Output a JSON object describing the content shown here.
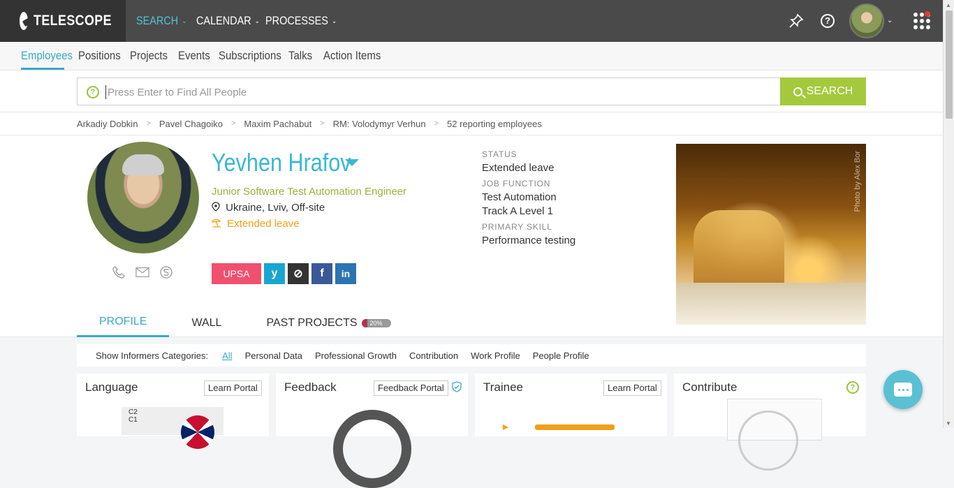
{
  "app": {
    "name": "TELESCOPE"
  },
  "topnav": [
    {
      "label": "SEARCH"
    },
    {
      "label": "CALENDAR"
    },
    {
      "label": "PROCESSES"
    }
  ],
  "subnav": [
    {
      "label": "Employees"
    },
    {
      "label": "Positions"
    },
    {
      "label": "Projects"
    },
    {
      "label": "Events"
    },
    {
      "label": "Subscriptions"
    },
    {
      "label": "Talks"
    },
    {
      "label": "Action Items"
    }
  ],
  "search": {
    "placeholder": "Press Enter to Find All People",
    "button": "SEARCH",
    "help": "?"
  },
  "breadcrumbs": [
    "Arkadiy Dobkin",
    "Pavel Chagoiko",
    "Maxim Pachabut",
    "RM: Volodymyr Verhun",
    "52 reporting employees"
  ],
  "profile": {
    "name": "Yevhen Hrafov",
    "title": "Junior Software Test Automation Engineer",
    "location": "Ukraine, Lviv, Off-site",
    "leave": "Extended leave",
    "badge": "UPSA",
    "status_label": "STATUS",
    "status": "Extended leave",
    "job_function_label": "JOB FUNCTION",
    "job_function": "Test Automation",
    "track": "Track A Level 1",
    "primary_skill_label": "PRIMARY SKILL",
    "primary_skill": "Performance testing",
    "photo_credit": "Photo by Alex Bor"
  },
  "tabs": [
    {
      "label": "PROFILE"
    },
    {
      "label": "WALL"
    },
    {
      "label": "PAST PROJECTS",
      "badge": "20%",
      "progress": 0.2
    }
  ],
  "filters": {
    "label": "Show Informers Categories:",
    "items": [
      "All",
      "Personal Data",
      "Professional Growth",
      "Contribution",
      "Work Profile",
      "People Profile"
    ]
  },
  "cards": [
    {
      "title": "Language",
      "button": "Learn Portal"
    },
    {
      "title": "Feedback",
      "button": "Feedback Portal"
    },
    {
      "title": "Trainee",
      "button": "Learn Portal"
    },
    {
      "title": "Contribute",
      "button": ""
    }
  ],
  "colors": {
    "accent": "#3aa9c7",
    "brand_green": "#a4c93d",
    "topbar": "#4a4a4a",
    "leave": "#f0a018",
    "upsa": "#f0506e"
  }
}
